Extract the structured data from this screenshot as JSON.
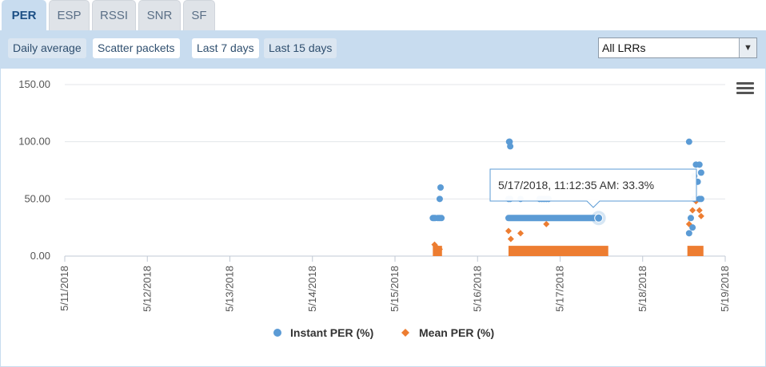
{
  "tabs": [
    {
      "label": "PER",
      "active": true
    },
    {
      "label": "ESP",
      "active": false
    },
    {
      "label": "RSSI",
      "active": false
    },
    {
      "label": "SNR",
      "active": false
    },
    {
      "label": "SF",
      "active": false
    }
  ],
  "toolbar": {
    "buttons": [
      {
        "label": "Daily average",
        "selected": false
      },
      {
        "label": "Scatter packets",
        "selected": true
      },
      {
        "label": "Last 7 days",
        "selected": true
      },
      {
        "label": "Last 15 days",
        "selected": false
      }
    ],
    "lrr_select": {
      "value": "All LRRs"
    }
  },
  "menu_icon": "hamburger-icon",
  "colors": {
    "instant": "#5b9bd5",
    "mean": "#ed7d31",
    "tooltip_border": "#5b9bd5"
  },
  "tooltip": {
    "text": "5/17/2018, 11:12:35 AM: 33.3%"
  },
  "chart_data": {
    "type": "scatter",
    "title": "",
    "xlabel": "",
    "ylabel": "",
    "x_tick_labels": [
      "5/11/2018",
      "5/12/2018",
      "5/13/2018",
      "5/14/2018",
      "5/15/2018",
      "5/16/2018",
      "5/17/2018",
      "5/18/2018",
      "5/19/2018"
    ],
    "y_tick_labels": [
      "0.00",
      "50.00",
      "100.00",
      "150.00"
    ],
    "xlim": [
      "2018-05-11",
      "2018-05-19"
    ],
    "ylim": [
      0,
      150
    ],
    "grid": "horizontal",
    "legend": "bottom-center",
    "series": [
      {
        "name": "Instant PER (%)",
        "marker": "circle",
        "points": [
          [
            "2018-05-15 11:00",
            33.3
          ],
          [
            "2018-05-15 11:20",
            33.3
          ],
          [
            "2018-05-15 11:40",
            33.3
          ],
          [
            "2018-05-15 12:30",
            33.3
          ],
          [
            "2018-05-15 13:00",
            33.3
          ],
          [
            "2018-05-15 13:30",
            33.3
          ],
          [
            "2018-05-15 13:00",
            50
          ],
          [
            "2018-05-15 13:15",
            60
          ],
          [
            "2018-05-16 09:10",
            100
          ],
          [
            "2018-05-16 09:20",
            100
          ],
          [
            "2018-05-16 09:30",
            96
          ],
          [
            "2018-05-16 09:00",
            50
          ],
          [
            "2018-05-16 09:30",
            50
          ],
          [
            "2018-05-16 12:30",
            50
          ],
          [
            "2018-05-16 18:00",
            50
          ],
          [
            "2018-05-16 18:40",
            50
          ],
          [
            "2018-05-16 19:20",
            50
          ],
          [
            "2018-05-16 20:00",
            50
          ],
          [
            "2018-05-16 20:40",
            50
          ],
          [
            "2018-05-17 11:12",
            33.3
          ],
          [
            "2018-05-18 13:30",
            100
          ],
          [
            "2018-05-18 15:30",
            80
          ],
          [
            "2018-05-18 16:30",
            80
          ],
          [
            "2018-05-18 17:00",
            73
          ],
          [
            "2018-05-18 15:00",
            70
          ],
          [
            "2018-05-18 16:00",
            65
          ],
          [
            "2018-05-18 15:00",
            50
          ],
          [
            "2018-05-18 16:30",
            50
          ],
          [
            "2018-05-18 17:00",
            50
          ],
          [
            "2018-05-18 14:00",
            33.3
          ],
          [
            "2018-05-18 14:30",
            25
          ],
          [
            "2018-05-18 13:30",
            20
          ]
        ]
      },
      {
        "name": "Mean PER (%)",
        "marker": "diamond",
        "points": [
          [
            "2018-05-15 11:30",
            10
          ],
          [
            "2018-05-15 12:00",
            8
          ],
          [
            "2018-05-15 13:00",
            6
          ],
          [
            "2018-05-16 09:00",
            22
          ],
          [
            "2018-05-16 09:40",
            15
          ],
          [
            "2018-05-16 12:30",
            20
          ],
          [
            "2018-05-16 20:00",
            28
          ],
          [
            "2018-05-18 13:30",
            28
          ],
          [
            "2018-05-18 14:30",
            40
          ],
          [
            "2018-05-18 15:30",
            48
          ],
          [
            "2018-05-18 16:30",
            40
          ],
          [
            "2018-05-18 17:00",
            35
          ]
        ]
      }
    ]
  }
}
